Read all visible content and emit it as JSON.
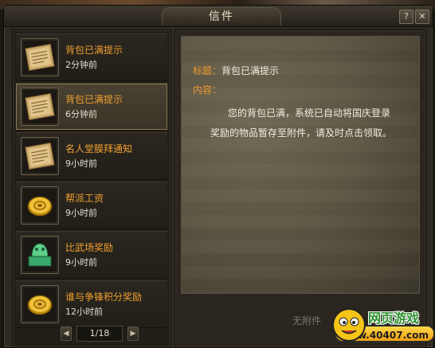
{
  "window": {
    "title": "信件",
    "help_label": "?",
    "close_label": "✕"
  },
  "mails": [
    {
      "title": "背包已满提示",
      "time": "2分钟前",
      "icon": "scroll-letter-icon",
      "selected": false
    },
    {
      "title": "背包已满提示",
      "time": "6分钟前",
      "icon": "scroll-letter-icon",
      "selected": true
    },
    {
      "title": "名人堂膜拜通知",
      "time": "9小时前",
      "icon": "scroll-letter-icon",
      "selected": false
    },
    {
      "title": "帮派工资",
      "time": "9小时前",
      "icon": "gold-coin-icon",
      "selected": false
    },
    {
      "title": "比武场奖励",
      "time": "9小时前",
      "icon": "jade-seal-icon",
      "selected": false
    },
    {
      "title": "谁与争锋积分奖励",
      "time": "12小时前",
      "icon": "gold-coin-icon",
      "selected": false
    }
  ],
  "pager": {
    "prev_label": "◀",
    "next_label": "▶",
    "current": "1/18"
  },
  "detail": {
    "subject_label": "标题：",
    "subject": "背包已满提示",
    "content_label": "内容：",
    "body_line_1": "您的背包已满，系统已自动将国庆登录",
    "body_line_2": "奖励的物品暂存至附件，请及时点击领取。",
    "attachment_text": "无附件"
  },
  "watermark": {
    "title": "网页游戏",
    "url": "www.40407.com"
  },
  "colors": {
    "accent_orange": "#f09a2a",
    "text_light": "#f2eee2",
    "panel_dark": "#221f19"
  }
}
